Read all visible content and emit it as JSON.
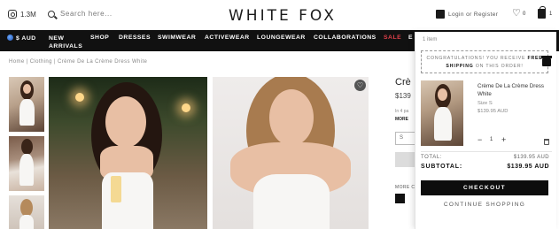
{
  "header": {
    "instagram_count": "1.3M",
    "search_placeholder": "Search here...",
    "logo": "WHITE FOX",
    "login_label": "Login or Register",
    "wishlist_count": "0",
    "bag_count": "1"
  },
  "nav": {
    "currency": "$ AUD",
    "items": [
      "NEW",
      "ARRIVALS",
      "SHOP",
      "DRESSES",
      "SWIMWEAR",
      "ACTIVEWEAR",
      "LOUNGEWEAR",
      "COLLABORATIONS",
      "SALE",
      "E"
    ]
  },
  "breadcrumb": "Home  |  Clothing  |  Crème De La Crème Dress White",
  "product": {
    "title": "Crè",
    "price": "$139",
    "info": "In 4 pa",
    "more": "MORE",
    "size": "S",
    "more_colours": "MORE C"
  },
  "cart": {
    "item_count": "1 item",
    "promo_text": "CONGRATULATIONS! YOU RECEIVE",
    "promo_bold1": "FREE",
    "promo_bold2": "SHIPPING",
    "promo_tail": "ON THIS ORDER!",
    "item_name": "Crème De La Crème Dress White",
    "item_size": "Size S",
    "item_price": "$139.95 AUD",
    "qty_minus": "−",
    "qty": "1",
    "qty_plus": "+",
    "total_label": "TOTAL:",
    "total_value": "$139.95 AUD",
    "subtotal_label": "SUBTOTAL:",
    "subtotal_value": "$139.95 AUD",
    "checkout_label": "CHECKOUT",
    "continue_label": "CONTINUE SHOPPING"
  },
  "icons": {
    "instagram": "instagram-icon",
    "search": "search-icon",
    "user": "user-icon",
    "wishlist": "heart-icon",
    "bag": "shopping-bag-icon",
    "gift": "gift-icon",
    "trash": "trash-icon"
  }
}
